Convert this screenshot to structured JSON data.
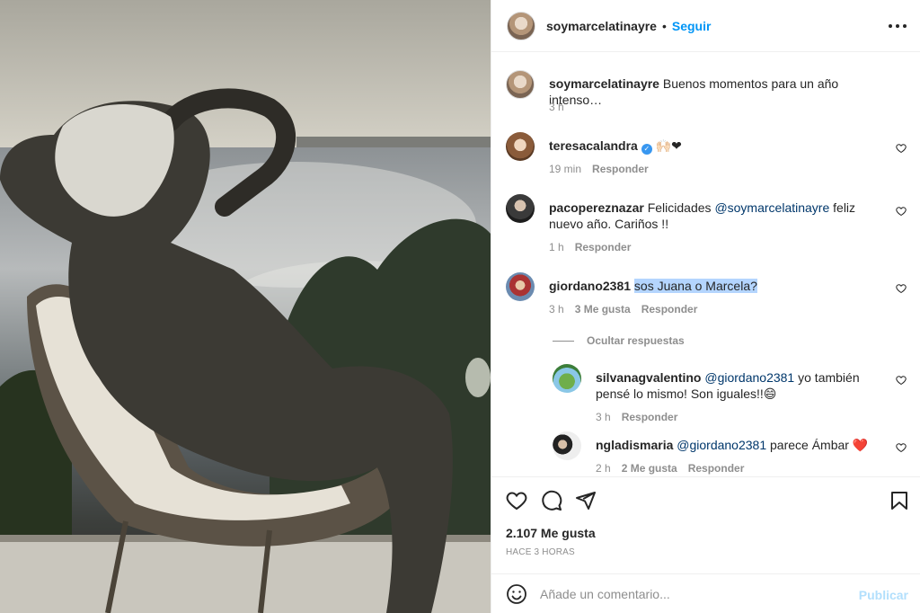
{
  "photo": {
    "description_icon": "photo"
  },
  "header": {
    "username": "soymarcelatinayre",
    "dot": "•",
    "follow_label": "Seguir",
    "more_icon": "more-horizontal-icon"
  },
  "caption": {
    "username": "soymarcelatinayre",
    "text": "Buenos momentos para un año intenso…",
    "time": "3 h"
  },
  "comments": [
    {
      "username": "teresacalandra",
      "verified": true,
      "text": "🙌🏻❤",
      "time": "19 min",
      "reply": "Responder"
    },
    {
      "username": "pacopereznazar",
      "text_before": "Felicidades",
      "mention": "@soymarcelatinayre",
      "text_after": "feliz nuevo año. Cariños !!",
      "time": "1 h",
      "reply": "Responder"
    },
    {
      "username": "giordano2381",
      "text": "sos Juana o Marcela?",
      "time": "3 h",
      "likes": "3 Me gusta",
      "reply": "Responder"
    }
  ],
  "hide_replies": "Ocultar respuestas",
  "replies": [
    {
      "username": "silvanagvalentino",
      "mention": "@giordano2381",
      "text": "yo también pensé lo mismo! Son iguales!!😄",
      "time": "3 h",
      "reply": "Responder"
    },
    {
      "username": "ngladismaria",
      "mention": "@giordano2381",
      "text": "parece Ámbar",
      "heart": "❤️",
      "time": "2 h",
      "likes": "2 Me gusta",
      "reply": "Responder"
    }
  ],
  "actions": {
    "likes": "2.107 Me gusta",
    "time_ago": "HACE 3 HORAS"
  },
  "composer": {
    "placeholder": "Añade un comentario...",
    "publish_label": "Publicar"
  }
}
